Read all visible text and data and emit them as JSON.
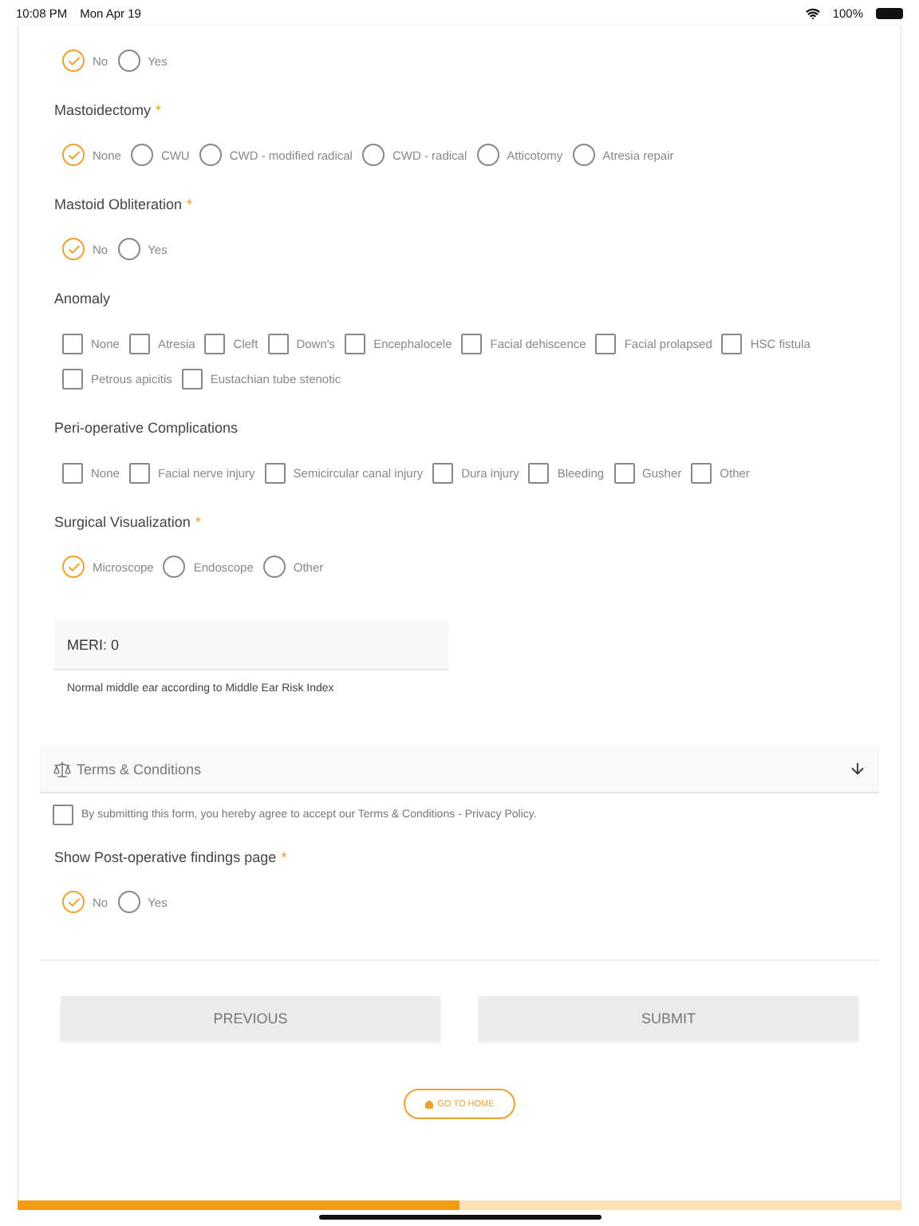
{
  "status_bar": {
    "time": "10:08 PM",
    "date": "Mon Apr 19",
    "battery": "100%"
  },
  "sections": [
    {
      "kind": "radio",
      "options": [
        {
          "label": "No",
          "selected": true
        },
        {
          "label": "Yes",
          "selected": false
        }
      ]
    },
    {
      "kind": "radio",
      "title": "Mastoidectomy",
      "marker": "*",
      "options": [
        {
          "label": "None",
          "selected": true
        },
        {
          "label": "CWU",
          "selected": false
        },
        {
          "label": "CWD - modified radical",
          "selected": false
        },
        {
          "label": "CWD - radical",
          "selected": false
        },
        {
          "label": "Atticotomy",
          "selected": false
        },
        {
          "label": "Atresia repair",
          "selected": false
        }
      ]
    },
    {
      "kind": "radio",
      "title": "Mastoid Obliteration",
      "marker": "*",
      "options": [
        {
          "label": "No",
          "selected": true
        },
        {
          "label": "Yes",
          "selected": false
        }
      ]
    },
    {
      "kind": "checkbox",
      "title": "Anomaly",
      "options": [
        {
          "label": "None",
          "checked": false
        },
        {
          "label": "Atresia",
          "checked": false
        },
        {
          "label": "Cleft",
          "checked": false
        },
        {
          "label": "Down's",
          "checked": false
        },
        {
          "label": "Encephalocele",
          "checked": false
        },
        {
          "label": "Facial dehiscence",
          "checked": false
        },
        {
          "label": "Facial prolapsed",
          "checked": false
        },
        {
          "label": "HSC fistula",
          "checked": false
        },
        {
          "label": "Petrous apicitis",
          "checked": false
        },
        {
          "label": "Eustachian tube stenotic",
          "checked": false
        }
      ]
    },
    {
      "kind": "checkbox",
      "title": "Peri-operative Complications",
      "options": [
        {
          "label": "None",
          "checked": false
        },
        {
          "label": "Facial nerve injury",
          "checked": false
        },
        {
          "label": "Semicircular canal injury",
          "checked": false
        },
        {
          "label": "Dura injury",
          "checked": false
        },
        {
          "label": "Bleeding",
          "checked": false
        },
        {
          "label": "Gusher",
          "checked": false
        },
        {
          "label": "Other",
          "checked": false
        }
      ]
    },
    {
      "kind": "radio",
      "title": "Surgical Visualization",
      "marker": "*",
      "options": [
        {
          "label": "Microscope",
          "selected": true
        },
        {
          "label": "Endoscope",
          "selected": false
        },
        {
          "label": "Other",
          "selected": false
        }
      ]
    }
  ],
  "meri": {
    "title": "MERI: 0",
    "description": "Normal middle ear according to Middle Ear Risk Index"
  },
  "terms": {
    "title": "Terms & Conditions",
    "agreement": "By submitting this form, you hereby agree to accept our Terms & Conditions - Privacy Policy.",
    "checked": false
  },
  "post_sections": [
    {
      "kind": "radio",
      "title": "Show Post-operative findings page",
      "marker": "*",
      "options": [
        {
          "label": "No",
          "selected": true
        },
        {
          "label": "Yes",
          "selected": false
        }
      ]
    }
  ],
  "buttons": {
    "previous": "PREVIOUS",
    "submit": "SUBMIT",
    "home": "GO TO HOME"
  },
  "progress": {
    "level": 0.5
  }
}
